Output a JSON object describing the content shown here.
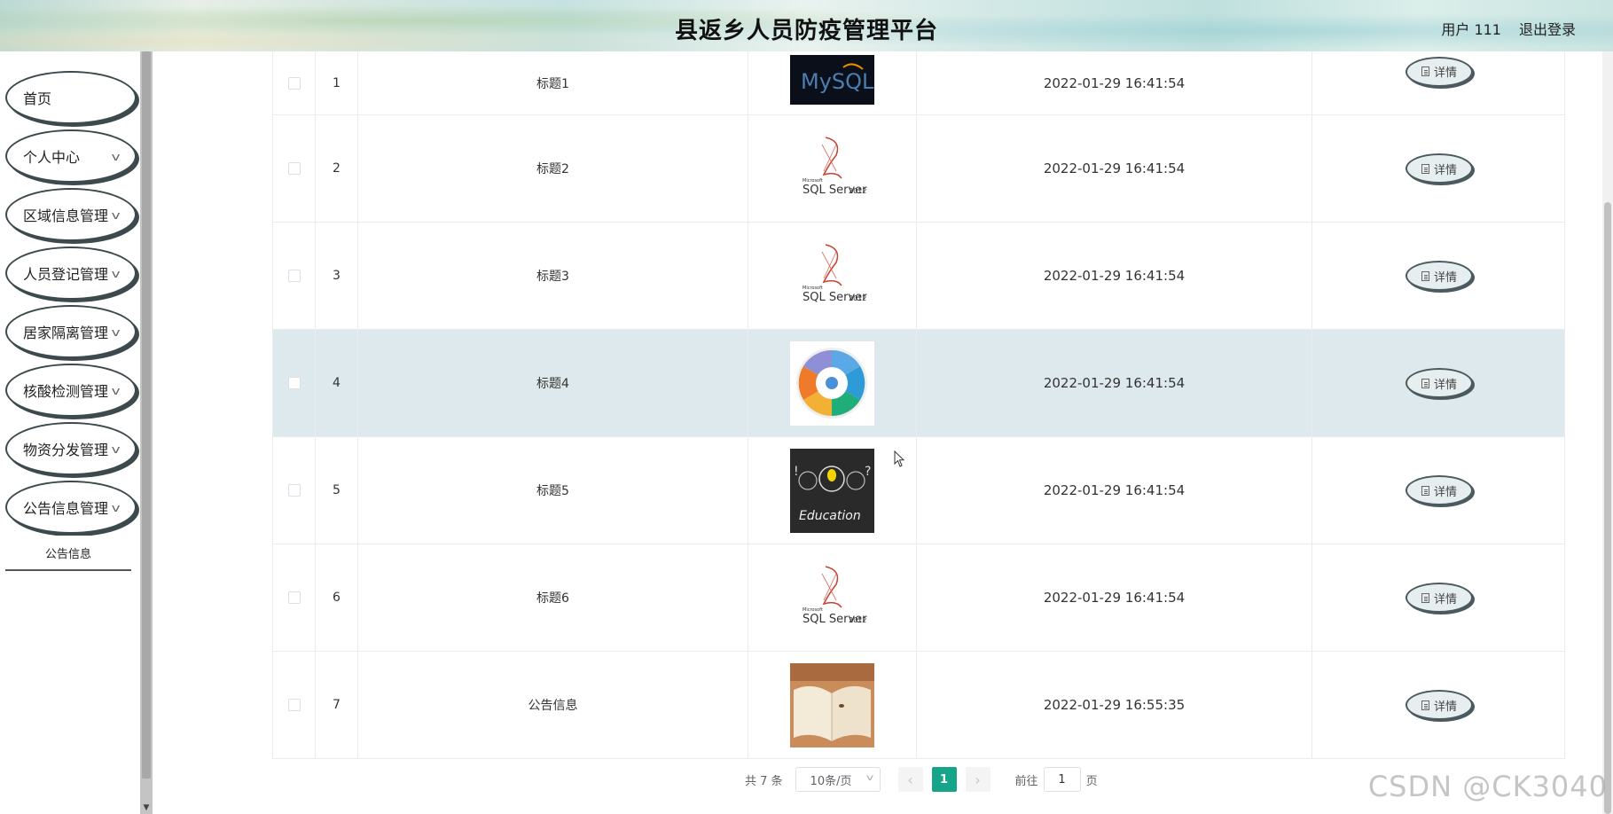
{
  "header": {
    "title": "县返乡人员防疫管理平台",
    "user_label": "用户 111",
    "logout_label": "退出登录"
  },
  "sidebar": {
    "items": [
      {
        "label": "首页",
        "has_chevron": false
      },
      {
        "label": "个人中心",
        "has_chevron": true
      },
      {
        "label": "区域信息管理",
        "has_chevron": true
      },
      {
        "label": "人员登记管理",
        "has_chevron": true
      },
      {
        "label": "居家隔离管理",
        "has_chevron": true
      },
      {
        "label": "核酸检测管理",
        "has_chevron": true
      },
      {
        "label": "物资分发管理",
        "has_chevron": true
      },
      {
        "label": "公告信息管理",
        "has_chevron": true
      }
    ],
    "submenu": {
      "label": "公告信息"
    }
  },
  "table": {
    "rows": [
      {
        "index": "1",
        "title": "标题1",
        "image": "mysql-logo",
        "time": "2022-01-29 16:41:54",
        "action": "详情"
      },
      {
        "index": "2",
        "title": "标题2",
        "image": "sqlserver-logo",
        "time": "2022-01-29 16:41:54",
        "action": "详情"
      },
      {
        "index": "3",
        "title": "标题3",
        "image": "sqlserver-logo",
        "time": "2022-01-29 16:41:54",
        "action": "详情"
      },
      {
        "index": "4",
        "title": "标题4",
        "image": "tech-wheel-diagram",
        "time": "2022-01-29 16:41:54",
        "action": "详情",
        "highlight": true
      },
      {
        "index": "5",
        "title": "标题5",
        "image": "education-chalkboard",
        "time": "2022-01-29 16:41:54",
        "action": "详情"
      },
      {
        "index": "6",
        "title": "标题6",
        "image": "sqlserver-logo",
        "time": "2022-01-29 16:41:54",
        "action": "详情"
      },
      {
        "index": "7",
        "title": "公告信息",
        "image": "open-book-photo",
        "time": "2022-01-29 16:55:35",
        "action": "详情"
      }
    ]
  },
  "pagination": {
    "total": "共 7 条",
    "page_size": "10条/页",
    "current_page": "1",
    "goto_prefix": "前往",
    "goto_value": "1",
    "goto_suffix": "页"
  },
  "image_texts": {
    "mysql": "MySQL",
    "sqlserver_small": "Microsoft",
    "sqlserver": "SQL Server",
    "sqlserver_year": "2012",
    "education": "Education"
  },
  "watermark": "CSDN @CK3040",
  "colors": {
    "accent": "#17a589",
    "row_highlight": "#dde9ec",
    "button_border": "#4a5a5e"
  }
}
